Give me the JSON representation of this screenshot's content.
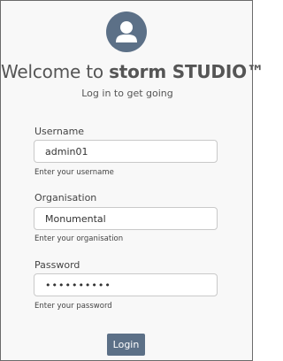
{
  "header": {
    "avatar_icon": "user-avatar-icon",
    "title_prefix": "Welcome to ",
    "brand": "storm STUDIO™",
    "subtitle": "Log in to get going"
  },
  "form": {
    "username": {
      "label": "Username",
      "value": "admin01",
      "hint": "Enter your username"
    },
    "organisation": {
      "label": "Organisation",
      "value": "Monumental",
      "hint": "Enter your organisation"
    },
    "password": {
      "label": "Password",
      "value": "••••••••••",
      "hint": "Enter your password"
    },
    "login_label": "Login"
  },
  "colors": {
    "avatar": "#5c7087",
    "button": "#5c7087",
    "background": "#f8f8f8",
    "border": "#6b6b6b"
  }
}
